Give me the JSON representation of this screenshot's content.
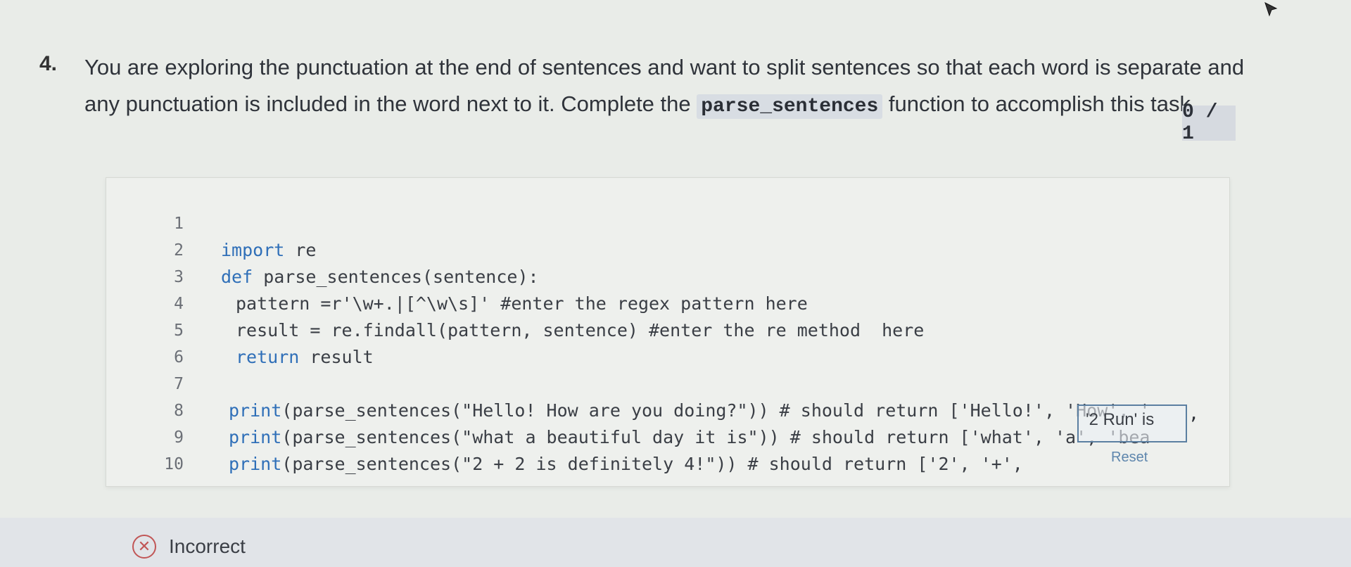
{
  "question": {
    "number": "4.",
    "text_before": "You are exploring the punctuation at the end of sentences and want to split sentences so that each word is separate and any punctuation is included in the word next to it. Complete the ",
    "code_term": "parse_sentences",
    "text_after": " function to accomplish this task.",
    "score": "0 / 1"
  },
  "editor": {
    "lines": [
      {
        "num": "1",
        "kw": "import",
        "rest": " re"
      },
      {
        "num": "2",
        "kw": "def",
        "rest": " parse_sentences(sentence):"
      },
      {
        "num": "3",
        "kw": "",
        "rest": "pattern =r'\\w+.|[^\\w\\s]' #enter the regex pattern here"
      },
      {
        "num": "4",
        "kw": "",
        "rest": "result = re.findall(pattern, sentence) #enter the re method  here"
      },
      {
        "num": "5",
        "kw": "return",
        "rest": " result"
      },
      {
        "num": "6",
        "kw": "",
        "rest": ""
      },
      {
        "num": "7",
        "kw": "print",
        "rest": "(parse_sentences(\"Hello! How are you doing?\")) # should return ['Hello!', 'How', '"
      },
      {
        "num": "8",
        "kw": "print",
        "rest": "(parse_sentences(\"what a beautiful day it is\")) # should return ['what', 'a', 'bea"
      },
      {
        "num": "9",
        "kw": "print",
        "rest": "(parse_sentences(\"2 + 2 is definitely 4!\")) # should return ['2', '+',"
      },
      {
        "num": "10",
        "kw": "",
        "rest": ""
      }
    ],
    "answer_overlay": "'2 Run' is",
    "answer_trailing": ",",
    "reset_label": "Reset"
  },
  "result": {
    "icon": "x-circle-icon",
    "label": "Incorrect",
    "color": "#c15656"
  }
}
